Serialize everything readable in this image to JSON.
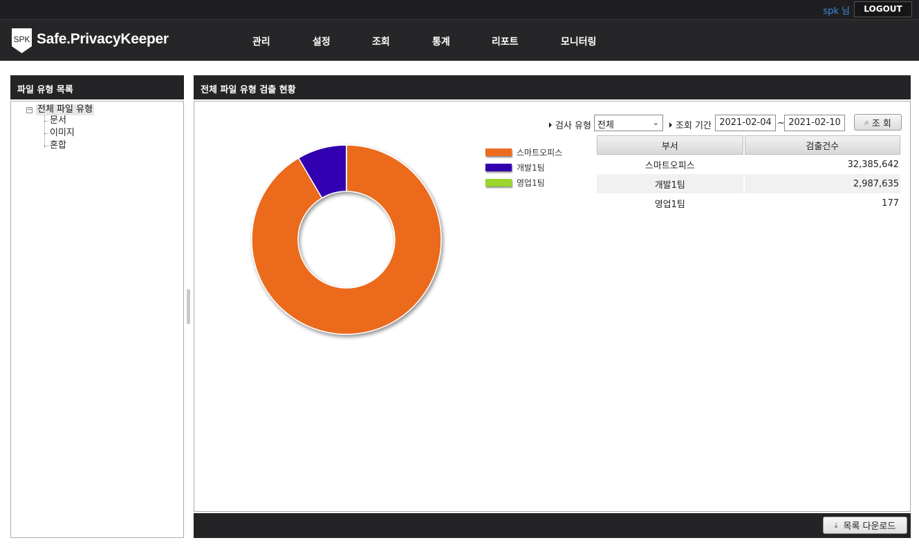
{
  "userbar": {
    "user": "spk 님",
    "logout": "LOGOUT"
  },
  "header": {
    "logo_badge": "SPK",
    "logo_text": "Safe.PrivacyKeeper",
    "nav": [
      "관리",
      "설정",
      "조회",
      "통계",
      "리포트",
      "모니터링"
    ]
  },
  "left_panel": {
    "title": "파일 유형 목록",
    "tree": {
      "toggle": "−",
      "root": "전체 파일 유형",
      "children": [
        "문서",
        "이미지",
        "혼합"
      ]
    }
  },
  "right_panel": {
    "title": "전체 파일 유형 검출 현황",
    "filters": {
      "type_label": "검사 유형",
      "type_value": "전체",
      "period_label": "조회 기간",
      "date_from": "2021-02-04",
      "tilde": "~",
      "date_to": "2021-02-10",
      "search_button": "조 회"
    },
    "table": {
      "headers": [
        "부서",
        "검출건수"
      ],
      "rows": [
        {
          "dept": "스마트오피스",
          "count": "32,385,642"
        },
        {
          "dept": "개발1팀",
          "count": "2,987,635"
        },
        {
          "dept": "영업1팀",
          "count": "177"
        }
      ]
    },
    "download_button": "목록 다운로드"
  },
  "chart_data": {
    "type": "pie",
    "variant": "donut",
    "legend_position": "right",
    "series": [
      {
        "name": "스마트오피스",
        "value": 32385642,
        "color": "#ec6b1e"
      },
      {
        "name": "개발1팀",
        "value": 2987635,
        "color": "#3300b0"
      },
      {
        "name": "영업1팀",
        "value": 177,
        "color": "#9ad62b"
      }
    ]
  },
  "icons": {
    "search": "⌕",
    "download": "⤓",
    "select_chevron": "⌄"
  }
}
